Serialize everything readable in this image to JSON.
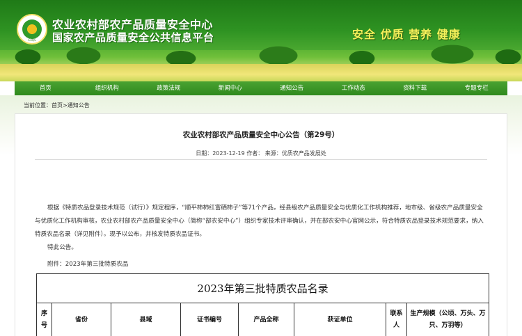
{
  "header": {
    "logo_text": "CAQS",
    "title": "农业农村部农产品质量安全中心",
    "subtitle": "国家农产品质量安全公共信息平台",
    "slogan": "安全 优质 营养 健康"
  },
  "nav": {
    "items": [
      "首页",
      "组织机构",
      "政策法规",
      "新闻中心",
      "通知公告",
      "工作动态",
      "资料下载",
      "专题专栏"
    ]
  },
  "breadcrumb": {
    "prefix": "当前位置：",
    "home": "首页",
    "sep": ">",
    "current": "通知公告"
  },
  "article": {
    "title": "农业农村部农产品质量安全中心公告（第29号）",
    "meta": "日期：2023-12-19 作者： 来源：优质农产品发展处",
    "body": "根据《特质农品登录技术规范（试行）》规定程序，“顺平柿柿红富硒柿子”等71个产品，经县级农产品质量安全与优质化工作机构推荐，地市级、省级农产品质量安全与优质化工作机构审核，农业农村部农产品质量安全中心（简称“部农安中心”）组织专家技术评审确认，并在部农安中心官网公示，符合特质农品登录技术规范要求，纳入特质农品名录（详见附件）。现予以公布，并核发特质农品证书。",
    "notice": "特此公告。",
    "attachment": "附件：2023年第三批特质农品"
  },
  "table": {
    "title": "2023年第三批特质农品名录",
    "headers": [
      "序号",
      "省份",
      "县域",
      "证书编号",
      "产品全称",
      "获证单位",
      "联系人",
      "生产规模（公顷、万头、万只、万羽等）"
    ]
  }
}
